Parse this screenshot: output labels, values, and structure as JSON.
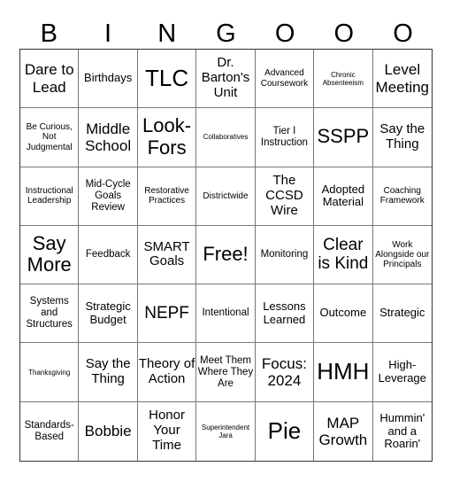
{
  "header": {
    "letters": [
      "B",
      "I",
      "N",
      "G",
      "O",
      "O",
      "O"
    ]
  },
  "cells": [
    "Dare to Lead",
    "Birthdays",
    "TLC",
    "Dr. Barton's Unit",
    "Advanced Coursework",
    "Chronic Absenteeism",
    "Level Meeting",
    "Be Curious, Not Judgmental",
    "Middle School",
    "Look-Fors",
    "Collaboratives",
    "Tier I Instruction",
    "SSPP",
    "Say the Thing",
    "Instructional Leadership",
    "Mid-Cycle Goals Review",
    "Restorative Practices",
    "Districtwide",
    "The CCSD Wire",
    "Adopted Material",
    "Coaching Framework",
    "Say More",
    "Feedback",
    "SMART Goals",
    "Free!",
    "Monitoring",
    "Clear is Kind",
    "Work Alongside our Principals",
    "Systems and Structures",
    "Strategic Budget",
    "NEPF",
    "Intentional",
    "Lessons Learned",
    "Outcome",
    "Strategic",
    "Thanksgiving",
    "Say the Thing",
    "Theory of Action",
    "Meet Them Where They Are",
    "Focus: 2024",
    "HMH",
    "High-Leverage",
    "Standards-Based",
    "Bobbie",
    "Honor Your Time",
    "Superintendent Jara",
    "Pie",
    "MAP Growth",
    "Hummin' and a Roarin'"
  ]
}
